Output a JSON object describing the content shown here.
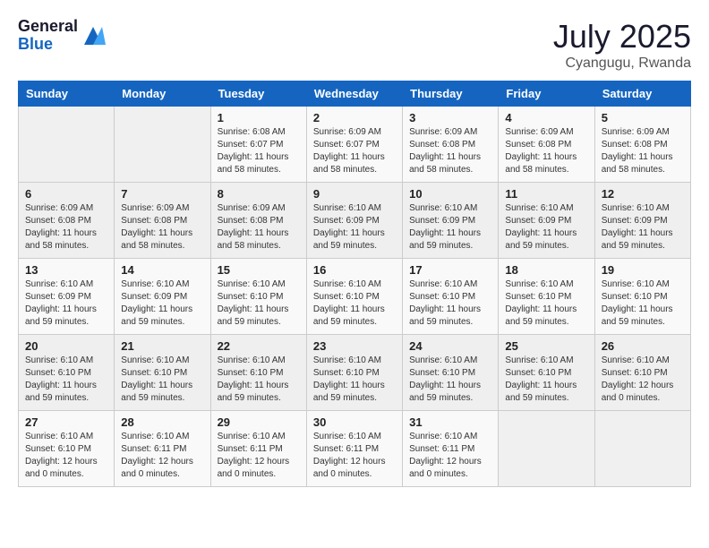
{
  "logo": {
    "general": "General",
    "blue": "Blue"
  },
  "title": "July 2025",
  "location": "Cyangugu, Rwanda",
  "weekdays": [
    "Sunday",
    "Monday",
    "Tuesday",
    "Wednesday",
    "Thursday",
    "Friday",
    "Saturday"
  ],
  "weeks": [
    [
      {
        "day": "",
        "empty": true
      },
      {
        "day": "",
        "empty": true
      },
      {
        "day": "1",
        "sunrise": "Sunrise: 6:08 AM",
        "sunset": "Sunset: 6:07 PM",
        "daylight": "Daylight: 11 hours and 58 minutes."
      },
      {
        "day": "2",
        "sunrise": "Sunrise: 6:09 AM",
        "sunset": "Sunset: 6:07 PM",
        "daylight": "Daylight: 11 hours and 58 minutes."
      },
      {
        "day": "3",
        "sunrise": "Sunrise: 6:09 AM",
        "sunset": "Sunset: 6:08 PM",
        "daylight": "Daylight: 11 hours and 58 minutes."
      },
      {
        "day": "4",
        "sunrise": "Sunrise: 6:09 AM",
        "sunset": "Sunset: 6:08 PM",
        "daylight": "Daylight: 11 hours and 58 minutes."
      },
      {
        "day": "5",
        "sunrise": "Sunrise: 6:09 AM",
        "sunset": "Sunset: 6:08 PM",
        "daylight": "Daylight: 11 hours and 58 minutes."
      }
    ],
    [
      {
        "day": "6",
        "sunrise": "Sunrise: 6:09 AM",
        "sunset": "Sunset: 6:08 PM",
        "daylight": "Daylight: 11 hours and 58 minutes."
      },
      {
        "day": "7",
        "sunrise": "Sunrise: 6:09 AM",
        "sunset": "Sunset: 6:08 PM",
        "daylight": "Daylight: 11 hours and 58 minutes."
      },
      {
        "day": "8",
        "sunrise": "Sunrise: 6:09 AM",
        "sunset": "Sunset: 6:08 PM",
        "daylight": "Daylight: 11 hours and 58 minutes."
      },
      {
        "day": "9",
        "sunrise": "Sunrise: 6:10 AM",
        "sunset": "Sunset: 6:09 PM",
        "daylight": "Daylight: 11 hours and 59 minutes."
      },
      {
        "day": "10",
        "sunrise": "Sunrise: 6:10 AM",
        "sunset": "Sunset: 6:09 PM",
        "daylight": "Daylight: 11 hours and 59 minutes."
      },
      {
        "day": "11",
        "sunrise": "Sunrise: 6:10 AM",
        "sunset": "Sunset: 6:09 PM",
        "daylight": "Daylight: 11 hours and 59 minutes."
      },
      {
        "day": "12",
        "sunrise": "Sunrise: 6:10 AM",
        "sunset": "Sunset: 6:09 PM",
        "daylight": "Daylight: 11 hours and 59 minutes."
      }
    ],
    [
      {
        "day": "13",
        "sunrise": "Sunrise: 6:10 AM",
        "sunset": "Sunset: 6:09 PM",
        "daylight": "Daylight: 11 hours and 59 minutes."
      },
      {
        "day": "14",
        "sunrise": "Sunrise: 6:10 AM",
        "sunset": "Sunset: 6:09 PM",
        "daylight": "Daylight: 11 hours and 59 minutes."
      },
      {
        "day": "15",
        "sunrise": "Sunrise: 6:10 AM",
        "sunset": "Sunset: 6:10 PM",
        "daylight": "Daylight: 11 hours and 59 minutes."
      },
      {
        "day": "16",
        "sunrise": "Sunrise: 6:10 AM",
        "sunset": "Sunset: 6:10 PM",
        "daylight": "Daylight: 11 hours and 59 minutes."
      },
      {
        "day": "17",
        "sunrise": "Sunrise: 6:10 AM",
        "sunset": "Sunset: 6:10 PM",
        "daylight": "Daylight: 11 hours and 59 minutes."
      },
      {
        "day": "18",
        "sunrise": "Sunrise: 6:10 AM",
        "sunset": "Sunset: 6:10 PM",
        "daylight": "Daylight: 11 hours and 59 minutes."
      },
      {
        "day": "19",
        "sunrise": "Sunrise: 6:10 AM",
        "sunset": "Sunset: 6:10 PM",
        "daylight": "Daylight: 11 hours and 59 minutes."
      }
    ],
    [
      {
        "day": "20",
        "sunrise": "Sunrise: 6:10 AM",
        "sunset": "Sunset: 6:10 PM",
        "daylight": "Daylight: 11 hours and 59 minutes."
      },
      {
        "day": "21",
        "sunrise": "Sunrise: 6:10 AM",
        "sunset": "Sunset: 6:10 PM",
        "daylight": "Daylight: 11 hours and 59 minutes."
      },
      {
        "day": "22",
        "sunrise": "Sunrise: 6:10 AM",
        "sunset": "Sunset: 6:10 PM",
        "daylight": "Daylight: 11 hours and 59 minutes."
      },
      {
        "day": "23",
        "sunrise": "Sunrise: 6:10 AM",
        "sunset": "Sunset: 6:10 PM",
        "daylight": "Daylight: 11 hours and 59 minutes."
      },
      {
        "day": "24",
        "sunrise": "Sunrise: 6:10 AM",
        "sunset": "Sunset: 6:10 PM",
        "daylight": "Daylight: 11 hours and 59 minutes."
      },
      {
        "day": "25",
        "sunrise": "Sunrise: 6:10 AM",
        "sunset": "Sunset: 6:10 PM",
        "daylight": "Daylight: 11 hours and 59 minutes."
      },
      {
        "day": "26",
        "sunrise": "Sunrise: 6:10 AM",
        "sunset": "Sunset: 6:10 PM",
        "daylight": "Daylight: 12 hours and 0 minutes."
      }
    ],
    [
      {
        "day": "27",
        "sunrise": "Sunrise: 6:10 AM",
        "sunset": "Sunset: 6:10 PM",
        "daylight": "Daylight: 12 hours and 0 minutes."
      },
      {
        "day": "28",
        "sunrise": "Sunrise: 6:10 AM",
        "sunset": "Sunset: 6:11 PM",
        "daylight": "Daylight: 12 hours and 0 minutes."
      },
      {
        "day": "29",
        "sunrise": "Sunrise: 6:10 AM",
        "sunset": "Sunset: 6:11 PM",
        "daylight": "Daylight: 12 hours and 0 minutes."
      },
      {
        "day": "30",
        "sunrise": "Sunrise: 6:10 AM",
        "sunset": "Sunset: 6:11 PM",
        "daylight": "Daylight: 12 hours and 0 minutes."
      },
      {
        "day": "31",
        "sunrise": "Sunrise: 6:10 AM",
        "sunset": "Sunset: 6:11 PM",
        "daylight": "Daylight: 12 hours and 0 minutes."
      },
      {
        "day": "",
        "empty": true
      },
      {
        "day": "",
        "empty": true
      }
    ]
  ]
}
